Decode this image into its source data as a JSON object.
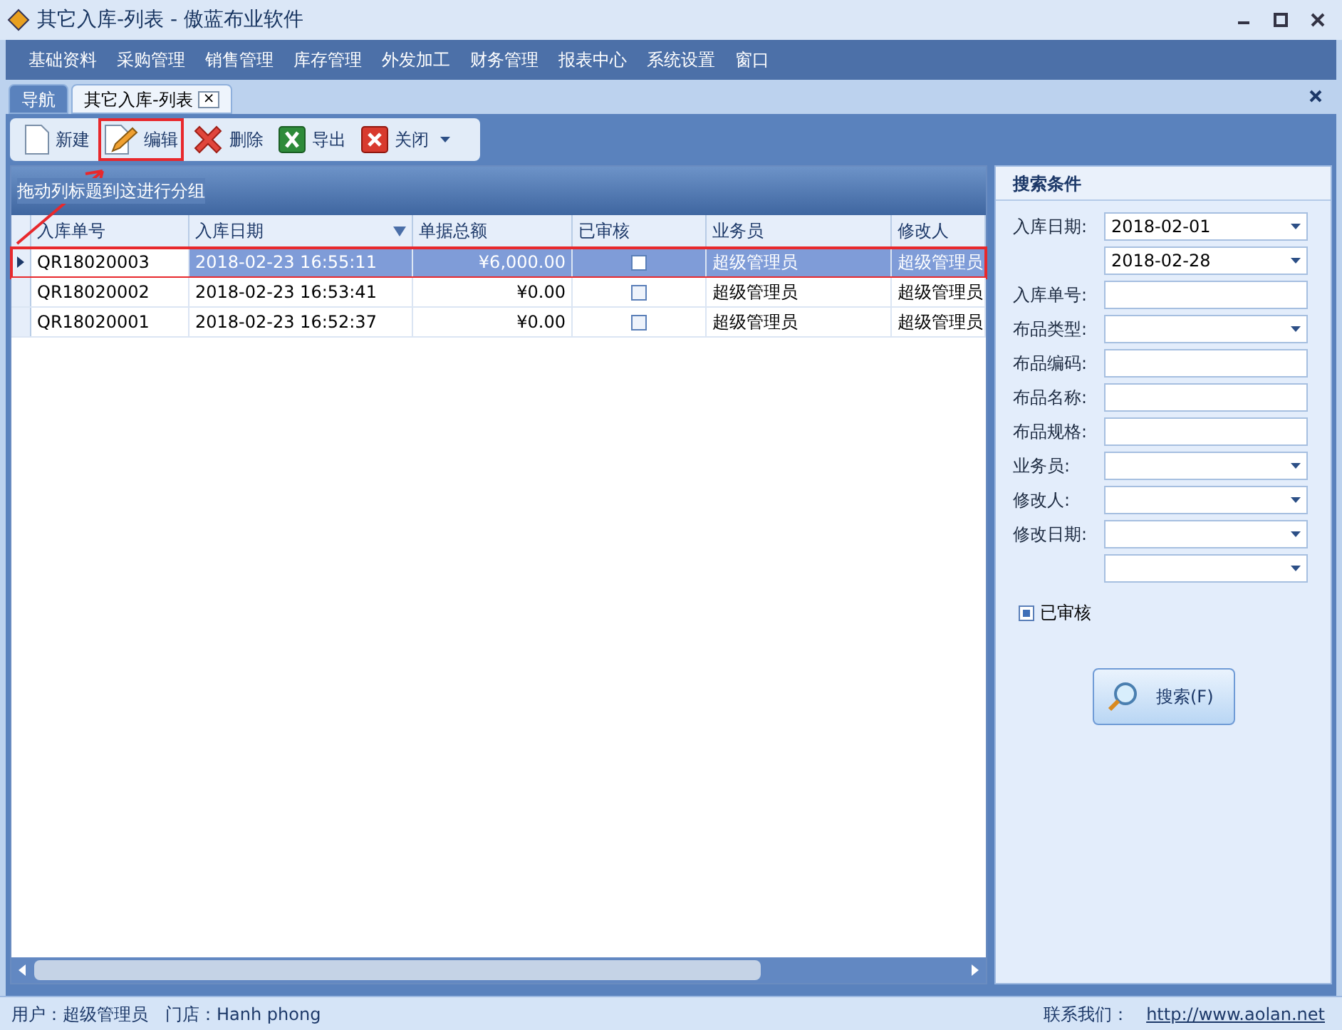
{
  "window": {
    "title": "其它入库-列表 - 傲蓝布业软件"
  },
  "menu": [
    "基础资料",
    "采购管理",
    "销售管理",
    "库存管理",
    "外发加工",
    "财务管理",
    "报表中心",
    "系统设置",
    "窗口"
  ],
  "tabs": [
    {
      "label": "导航",
      "selected": false,
      "closable": false
    },
    {
      "label": "其它入库-列表",
      "selected": true,
      "closable": true
    }
  ],
  "close_tab_glyph": "×",
  "toolbar": [
    {
      "label": "新建",
      "kind": "new",
      "highlighted": false
    },
    {
      "label": "编辑",
      "kind": "edit",
      "highlighted": true
    },
    {
      "label": "删除",
      "kind": "delete",
      "highlighted": false
    },
    {
      "label": "导出",
      "kind": "excel",
      "highlighted": false
    },
    {
      "label": "关闭",
      "kind": "close",
      "highlighted": false
    }
  ],
  "grid": {
    "group_hint": "拖动列标题到这进行分组",
    "columns": [
      {
        "label": "入库单号",
        "sorted": false
      },
      {
        "label": "入库日期",
        "sorted": true
      },
      {
        "label": "单据总额",
        "sorted": false
      },
      {
        "label": "已审核",
        "sorted": false
      },
      {
        "label": "业务员",
        "sorted": false
      },
      {
        "label": "修改人",
        "sorted": false
      }
    ],
    "rows": [
      {
        "selected": true,
        "highlighted": true,
        "number": "QR18020003",
        "date": "2018-02-23 16:55:11",
        "amount": "¥6,000.00",
        "checked": false,
        "salesman": "超级管理员",
        "modifier": "超级管理员"
      },
      {
        "selected": false,
        "highlighted": false,
        "number": "QR18020002",
        "date": "2018-02-23 16:53:41",
        "amount": "¥0.00",
        "checked": false,
        "salesman": "超级管理员",
        "modifier": "超级管理员"
      },
      {
        "selected": false,
        "highlighted": false,
        "number": "QR18020001",
        "date": "2018-02-23 16:52:37",
        "amount": "¥0.00",
        "checked": false,
        "salesman": "超级管理员",
        "modifier": "超级管理员"
      }
    ]
  },
  "search": {
    "title": "搜索条件",
    "fields": [
      {
        "label": "入库日期:",
        "kind": "select",
        "value": "2018-02-01"
      },
      {
        "kind": "select",
        "value": "2018-02-28"
      },
      {
        "label": "入库单号:",
        "kind": "text"
      },
      {
        "label": "布品类型:",
        "kind": "select"
      },
      {
        "label": "布品编码:",
        "kind": "text"
      },
      {
        "label": "布品名称:",
        "kind": "text"
      },
      {
        "label": "布品规格:",
        "kind": "text"
      },
      {
        "label": "业务员:",
        "kind": "select"
      },
      {
        "label": "修改人:",
        "kind": "select"
      },
      {
        "label": "修改日期:",
        "kind": "select"
      },
      {
        "kind": "select"
      }
    ],
    "audited": {
      "label": "已审核",
      "checked": true
    },
    "button": "搜索(F)"
  },
  "status_bar": {
    "user": "用户：超级管理员",
    "store": "门店：Hanh phong",
    "contact": "联系我们：",
    "link": "http://www.aolan.net"
  }
}
